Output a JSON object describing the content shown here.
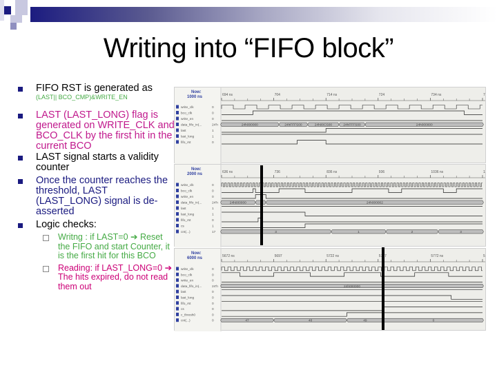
{
  "title": "Writing into “FIFO block”",
  "colors": {
    "accent": "#1a1a80",
    "pink": "#c0188c",
    "navy": "#1a1a80",
    "green": "#44aa44",
    "magenta": "#cc0077"
  },
  "bullets": [
    {
      "text": "FIFO RST is generated as",
      "note": "(LAST|| BCO_CMP)&WRITE_EN"
    },
    {
      "text": "LAST (LAST_LONG) flag is generated on WRITE_CLK and BCO_CLK by the first hit in the current BCO"
    },
    {
      "text": "LAST signal starts a validity counter"
    },
    {
      "text": "Once the counter reaches the threshold, LAST (LAST_LONG) signal is de-asserted"
    },
    {
      "text": "Logic checks:"
    }
  ],
  "subbullets": [
    {
      "text": "Writng : if LAST=0 ➔ Reset the FIFO and start Counter, it is the first hit for this BCO"
    },
    {
      "text": "Reading: if LAST_LONG=0 ➔ The hits expired, do not read them out"
    }
  ],
  "panels": [
    {
      "now": "Now:",
      "now_time": "1000 ns",
      "ticks": [
        "694 ns",
        "704",
        "714 ns",
        "724",
        "734 ns",
        "744"
      ],
      "signals": [
        {
          "name": "write_clk",
          "value": "0"
        },
        {
          "name": "bco_clk",
          "value": "0"
        },
        {
          "name": "write_en",
          "value": "0"
        },
        {
          "name": "data_fifo_in(...",
          "value": "24'h"
        },
        {
          "name": "last",
          "value": "1"
        },
        {
          "name": "last_long",
          "value": "1"
        },
        {
          "name": "fifo_rst",
          "value": "0"
        }
      ],
      "bus": [
        "24h000000",
        "24hFFFS00",
        "24h00CS00",
        "24hFFFS00",
        "24h000000"
      ]
    },
    {
      "now": "Now:",
      "now_time": "2000 ns",
      "ticks": [
        "636 ns",
        "736",
        "836 ns",
        "936",
        "1036 ns",
        "1136"
      ],
      "signals": [
        {
          "name": "write_clk",
          "value": "0"
        },
        {
          "name": "bco_clk",
          "value": "0"
        },
        {
          "name": "write_en",
          "value": "0"
        },
        {
          "name": "data_fifo_in(...",
          "value": "24'h"
        },
        {
          "name": "last",
          "value": "1"
        },
        {
          "name": "last_long",
          "value": "1"
        },
        {
          "name": "fifo_rst",
          "value": "0"
        },
        {
          "name": "cs",
          "value": "1"
        },
        {
          "name": "cnt(...)",
          "value": "17"
        }
      ],
      "bus": [
        "24h000000",
        "24h000002"
      ],
      "counter": [
        "3",
        "1",
        "2",
        "3"
      ]
    },
    {
      "now": "Now:",
      "now_time": "6000 ns",
      "ticks": [
        "5672 ns",
        "5697",
        "5722 ns",
        "5747",
        "5772 ns",
        "5797"
      ],
      "signals": [
        {
          "name": "write_clk",
          "value": "0"
        },
        {
          "name": "bco_clk",
          "value": "0"
        },
        {
          "name": "write_en",
          "value": "0"
        },
        {
          "name": "data_fifo_in(...",
          "value": "24'h"
        },
        {
          "name": "last",
          "value": "0"
        },
        {
          "name": "last_long",
          "value": "0"
        },
        {
          "name": "fifo_rst",
          "value": "0"
        },
        {
          "name": "cs",
          "value": "0"
        },
        {
          "name": "c_thresh0",
          "value": "0"
        },
        {
          "name": "cnt(...)",
          "value": "0"
        }
      ],
      "bus": [
        "24h000000"
      ],
      "counter": [
        "47",
        "48",
        "49",
        "0"
      ]
    }
  ]
}
